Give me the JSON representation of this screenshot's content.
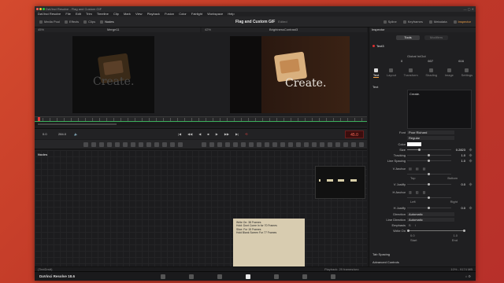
{
  "window": {
    "title": "DaVinci Resolve - Flag and Custom GIF",
    "controls": "— ▢ ✕"
  },
  "menu": [
    "DaVinci Resolve",
    "File",
    "Edit",
    "Trim",
    "Timeline",
    "Clip",
    "Mark",
    "View",
    "Playback",
    "Fusion",
    "Color",
    "Fairlight",
    "Workspace",
    "Help"
  ],
  "toolbar": {
    "left": [
      "Media Pool",
      "Effects",
      "Clips",
      "Nodes"
    ],
    "project_title": "Flag and Custom GIF",
    "project_sub": "Edited",
    "right": [
      "Spline",
      "Keyframes",
      "Metadata",
      "Inspector"
    ]
  },
  "viewer_left": {
    "zoom": "45%",
    "name": "Merge11",
    "overlay_text": "Create."
  },
  "viewer_right": {
    "zoom": "42%",
    "name": "BrightnessContrast3",
    "overlay_text": "Create."
  },
  "transport": {
    "start": "0.0",
    "end": "284.0",
    "frame": "45.0",
    "controls": [
      "|◀",
      "◀◀",
      "◀",
      "■",
      "▶",
      "▶▶",
      "▶|"
    ],
    "loop": "⟲"
  },
  "nodes": {
    "header": "Nodes",
    "sticky_note": [
      "Write On: 38 Frames",
      "Hold: Dont Come In for 70 Frames",
      "Slice: For 15 Frames",
      "Hold Blank Screen For 77 Frames"
    ]
  },
  "status": {
    "left": "(TextDrstt)",
    "middle": "Playback: 29 frames/sec",
    "right": "10% - 9174 MB"
  },
  "bottom": {
    "brand": "DaVinci Resolve 18.6"
  },
  "inspector": {
    "header": "Inspector",
    "tabs": [
      "Tools",
      "Modifiers"
    ],
    "node_name": "Text3",
    "global_label": "Global In/Out",
    "global_values": [
      "0",
      "607",
      "616"
    ],
    "subtabs": [
      "Text",
      "Layout",
      "Transform",
      "Shading",
      "Image",
      "Settings"
    ],
    "section_text": "Text",
    "styled_text": "Create.",
    "rows": {
      "font_label": "Font",
      "font_value": "Poor Richard",
      "style_value": "Regular",
      "color_label": "Color",
      "size_label": "Size",
      "size_value": "0.2823",
      "tracking_label": "Tracking",
      "tracking_value": "1.0",
      "line_spacing_label": "Line Spacing",
      "line_spacing_value": "1.0",
      "v_anchor_label": "V Anchor",
      "v_anchor_opts": [
        "Top",
        "Bottom"
      ],
      "v_justify_label": "V Justify",
      "v_justify_value": "0.0",
      "h_anchor_label": "H Anchor",
      "h_anchor_opts": [
        "Left",
        "Right"
      ],
      "h_justify_label": "H Justify",
      "h_justify_value": "0.0",
      "direction_label": "Direction",
      "direction_value": "Automatic",
      "line_direction_label": "Line Direction",
      "line_direction_value": "Automatic",
      "emphasis_label": "Emphasis",
      "write_on_label": "Write On",
      "write_on_start": "0.0",
      "write_on_end": "1.0",
      "write_on_start_lbl": "Start",
      "write_on_end_lbl": "End",
      "write_on_progress": 1.0
    },
    "collapsed": [
      "Tab Spacing",
      "Advanced Controls"
    ]
  },
  "colors": {
    "accent": "#f0a045",
    "frame_counter": "#ff6b5a",
    "desktop": "#c13a28"
  }
}
